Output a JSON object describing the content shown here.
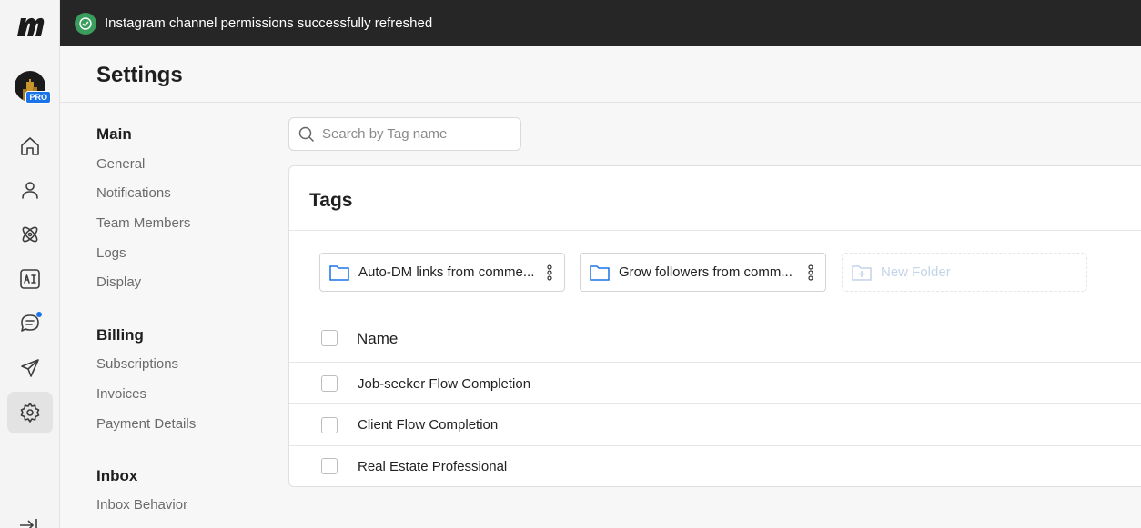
{
  "toast": {
    "message": "Instagram channel permissions successfully refreshed",
    "status_color": "#3a9d5d"
  },
  "rail": {
    "avatar_badge": "PRO",
    "items": [
      {
        "name": "home-icon",
        "active": false
      },
      {
        "name": "contacts-icon",
        "active": false
      },
      {
        "name": "automation-icon",
        "active": false
      },
      {
        "name": "ai-icon",
        "active": false
      },
      {
        "name": "chat-icon",
        "active": false,
        "has_notification": true
      },
      {
        "name": "broadcast-icon",
        "active": false
      },
      {
        "name": "settings-icon",
        "active": true
      }
    ]
  },
  "header": {
    "title": "Settings"
  },
  "nav": {
    "sections": [
      {
        "title": "Main",
        "items": [
          "General",
          "Notifications",
          "Team Members",
          "Logs",
          "Display"
        ]
      },
      {
        "title": "Billing",
        "items": [
          "Subscriptions",
          "Invoices",
          "Payment Details"
        ]
      },
      {
        "title": "Inbox",
        "items": [
          "Inbox Behavior"
        ]
      }
    ]
  },
  "search": {
    "placeholder": "Search by Tag name",
    "value": ""
  },
  "tags": {
    "title": "Tags",
    "folders": [
      {
        "label": "Auto-DM links from comme..."
      },
      {
        "label": "Grow followers from comm..."
      }
    ],
    "new_folder_label": "New Folder",
    "column_name": "Name",
    "rows": [
      {
        "label": "Job-seeker Flow Completion"
      },
      {
        "label": "Client Flow Completion"
      },
      {
        "label": "Real Estate Professional"
      }
    ]
  },
  "colors": {
    "accent": "#1a73e8",
    "toast_bg": "#262626"
  }
}
